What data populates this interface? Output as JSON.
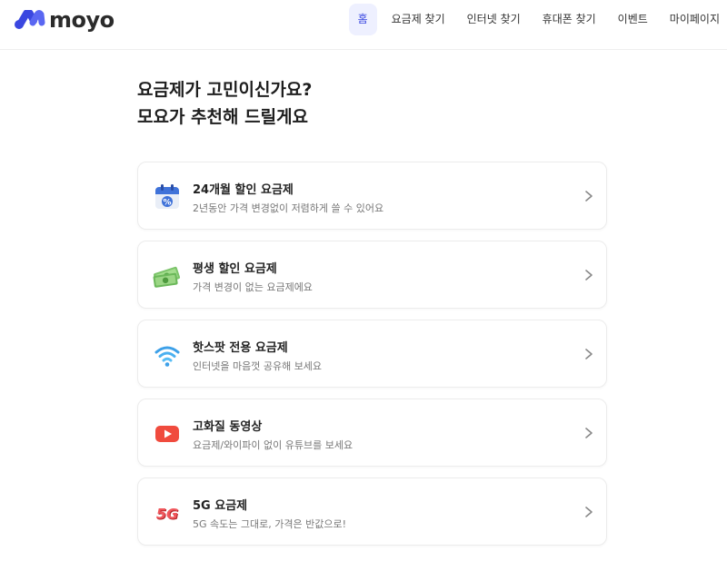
{
  "brand": {
    "name": "moyo",
    "color": "#3a47e0"
  },
  "nav": {
    "items": [
      {
        "label": "홈",
        "active": true
      },
      {
        "label": "요금제 찾기",
        "active": false
      },
      {
        "label": "인터넷 찾기",
        "active": false
      },
      {
        "label": "휴대폰 찾기",
        "active": false
      },
      {
        "label": "이벤트",
        "active": false
      },
      {
        "label": "마이페이지",
        "active": false
      }
    ]
  },
  "headline": {
    "line1": "요금제가 고민이신가요?",
    "line2": "모요가 추천해 드릴게요"
  },
  "cards": [
    {
      "icon": "calendar-percent-icon",
      "title": "24개월 할인 요금제",
      "desc": "2년동안 가격 변경없이 저렴하게 쓸 수 있어요"
    },
    {
      "icon": "money-icon",
      "title": "평생 할인 요금제",
      "desc": "가격 변경이 없는 요금제에요"
    },
    {
      "icon": "wifi-icon",
      "title": "핫스팟 전용 요금제",
      "desc": "인터넷을 마음껏 공유해 보세요"
    },
    {
      "icon": "play-icon",
      "title": "고화질 동영상",
      "desc": "요금제/와이파이 없이 유튜브를 보세요"
    },
    {
      "icon": "5g-icon",
      "title": "5G 요금제",
      "desc": "5G 속도는 그대로, 가격은 반값으로!"
    }
  ],
  "five_g_text": "5G"
}
